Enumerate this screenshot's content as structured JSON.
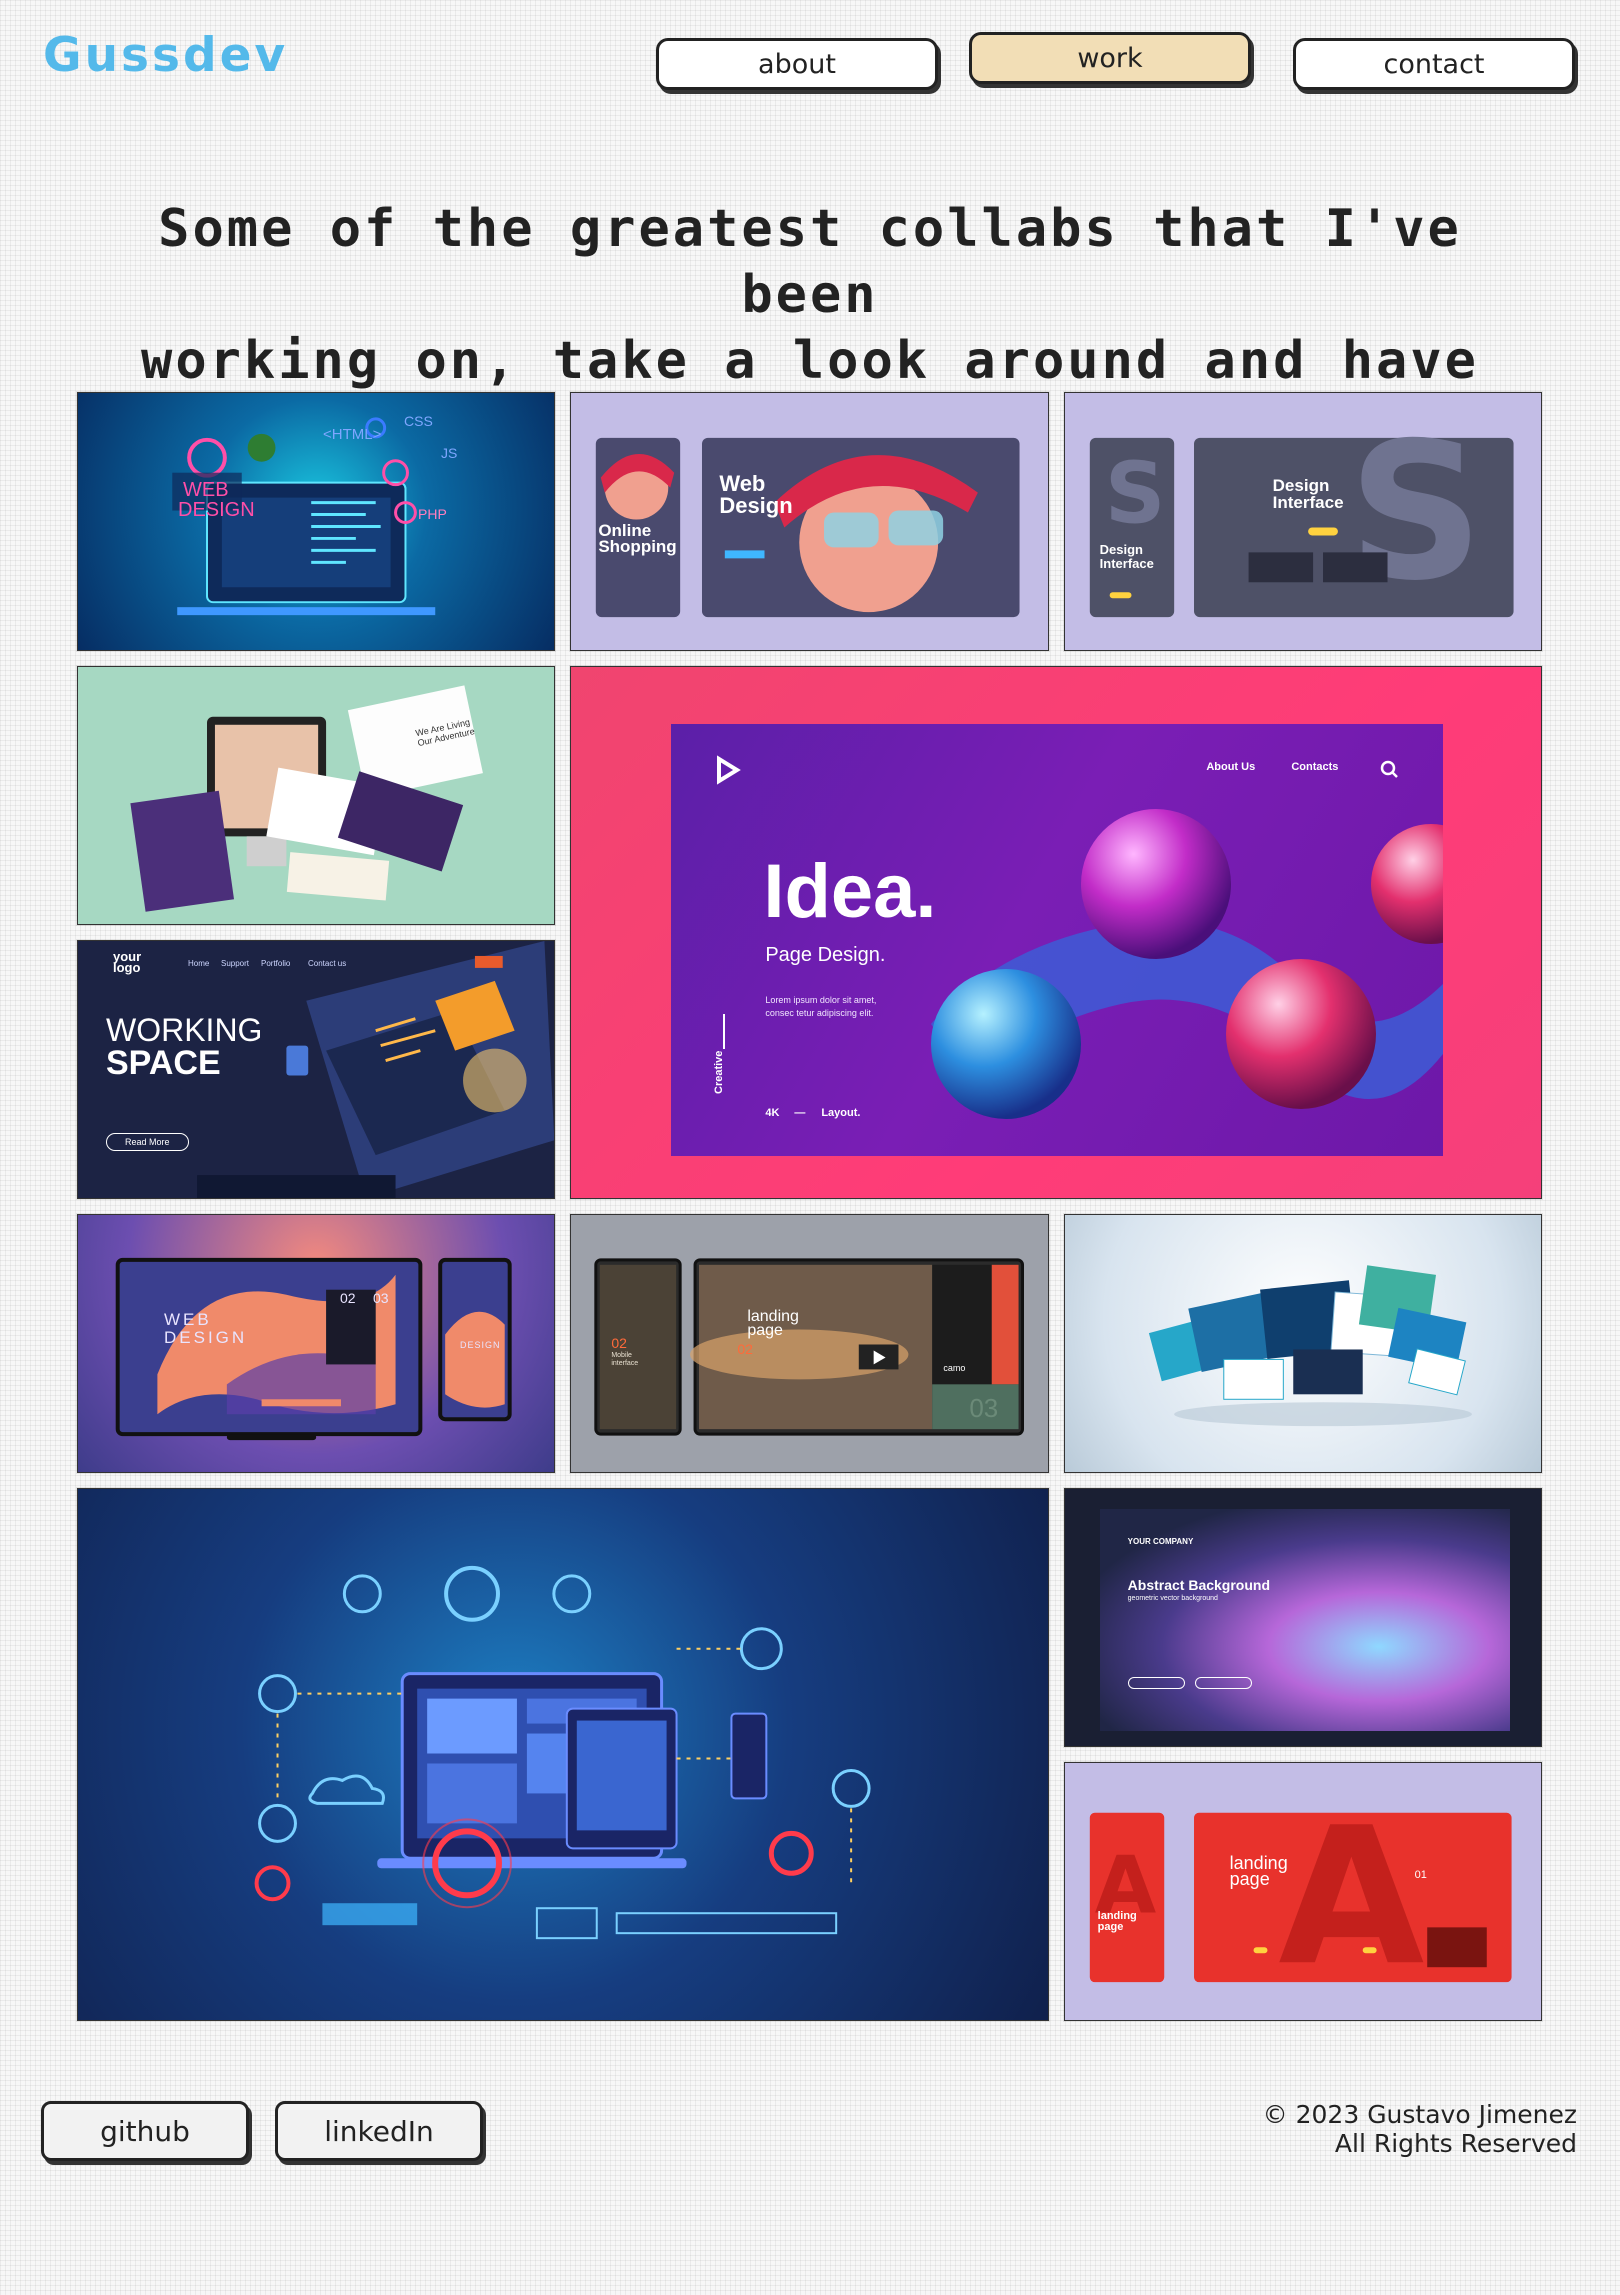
{
  "header": {
    "logo": "Gussdev",
    "nav": [
      {
        "label": "about",
        "active": false
      },
      {
        "label": "work",
        "active": true
      },
      {
        "label": "contact",
        "active": false
      }
    ]
  },
  "main": {
    "headline_line1": "Some of the greatest collabs that I've been",
    "headline_line2": "working on, take a look around and have fun",
    "tiles": [
      {
        "title": "web design laptop illustration",
        "texts": [
          "WEB",
          "DESIGN",
          "<HTML>",
          "CSS",
          "JS",
          "PHP"
        ]
      },
      {
        "title": "web design online shopping",
        "texts": [
          "Online Shopping",
          "Web Design"
        ]
      },
      {
        "title": "design interface",
        "texts": [
          "Design Interface",
          "Design Interface"
        ]
      },
      {
        "title": "website mockups on screens",
        "texts": [
          "We Are Living Our Adventure"
        ]
      },
      {
        "title": "idea page design",
        "texts": [
          "About Us",
          "Contacts",
          "Idea.",
          "Page Design.",
          "Lorem ipsum dolor sit amet, consec tetur adipiscing elit.",
          "Creative",
          "4K",
          "—",
          "Layout."
        ]
      },
      {
        "title": "working space isometric",
        "texts": [
          "your logo",
          "Home",
          "Support",
          "Portfolio",
          "Contact us",
          "WORKING",
          "SPACE",
          "Read More"
        ]
      },
      {
        "title": "web design gradient",
        "texts": [
          "WEB",
          "DESIGN",
          "02",
          "03",
          "DESIGN"
        ]
      },
      {
        "title": "landing page mobile interface",
        "texts": [
          "02",
          "Mobile interface",
          "landing page",
          "02",
          "camo",
          "03"
        ]
      },
      {
        "title": "3d website screens",
        "texts": []
      },
      {
        "title": "data technology illustration",
        "texts": []
      },
      {
        "title": "abstract background",
        "texts": [
          "YOUR COMPANY",
          "Abstract Background",
          "geometric vector background"
        ]
      },
      {
        "title": "landing page red",
        "texts": [
          "landing page",
          "landing page",
          "01"
        ]
      }
    ]
  },
  "footer": {
    "github_label": "github",
    "linkedin_label": "linkedIn",
    "copyright_line1": "© 2023 Gustavo Jimenez",
    "copyright_line2": "All Rights Reserved"
  },
  "colors": {
    "logo": "#54b9ea",
    "active_nav": "#f2deb6",
    "tile_lavender": "#c3bde6",
    "tile_mint": "#a6d8c2",
    "tile_pink": "#ff3c78"
  }
}
